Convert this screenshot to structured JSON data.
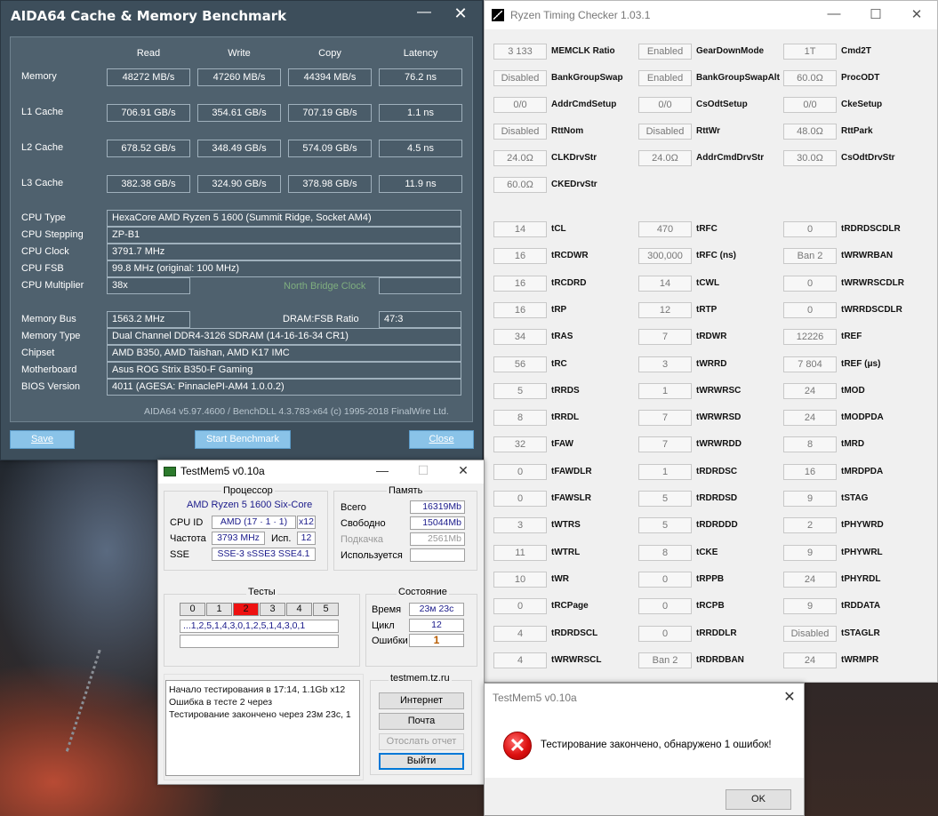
{
  "aida": {
    "title": "AIDA64 Cache & Memory Benchmark",
    "min_glyph": "—",
    "close_glyph": "✕",
    "columns": [
      "Read",
      "Write",
      "Copy",
      "Latency"
    ],
    "bench_rows": [
      {
        "label": "Memory",
        "values": [
          "48272 MB/s",
          "47260 MB/s",
          "44394 MB/s",
          "76.2 ns"
        ]
      },
      {
        "label": "L1 Cache",
        "values": [
          "706.91 GB/s",
          "354.61 GB/s",
          "707.19 GB/s",
          "1.1 ns"
        ]
      },
      {
        "label": "L2 Cache",
        "values": [
          "678.52 GB/s",
          "348.49 GB/s",
          "574.09 GB/s",
          "4.5 ns"
        ]
      },
      {
        "label": "L3 Cache",
        "values": [
          "382.38 GB/s",
          "324.90 GB/s",
          "378.98 GB/s",
          "11.9 ns"
        ]
      }
    ],
    "info_rows": [
      {
        "label": "CPU Type",
        "value": "HexaCore AMD Ryzen 5 1600  (Summit Ridge, Socket AM4)"
      },
      {
        "label": "CPU Stepping",
        "value": "ZP-B1"
      },
      {
        "label": "CPU Clock",
        "value": "3791.7 MHz"
      },
      {
        "label": "CPU FSB",
        "value": "99.8 MHz  (original: 100 MHz)"
      },
      {
        "label": "CPU Multiplier",
        "value": "38x"
      }
    ],
    "north_bridge_label": "North Bridge Clock",
    "mem_bus_label": "Memory Bus",
    "mem_bus_value": "1563.2 MHz",
    "dram_fsb_label": "DRAM:FSB Ratio",
    "dram_fsb_value": "47:3",
    "sys_rows": [
      {
        "label": "Memory Type",
        "value": "Dual Channel DDR4-3126 SDRAM  (14-16-16-34 CR1)"
      },
      {
        "label": "Chipset",
        "value": "AMD B350, AMD Taishan, AMD K17 IMC"
      },
      {
        "label": "Motherboard",
        "value": "Asus ROG Strix B350-F Gaming"
      },
      {
        "label": "BIOS Version",
        "value": "4011  (AGESA: PinnaclePI-AM4 1.0.0.2)"
      }
    ],
    "footer": "AIDA64 v5.97.4600 / BenchDLL 4.3.783-x64  (c) 1995-2018 FinalWire Ltd.",
    "buttons": {
      "save": "Save",
      "start": "Start Benchmark",
      "close": "Close"
    }
  },
  "rtc": {
    "title": "Ryzen Timing Checker 1.03.1",
    "tb": {
      "min": "—",
      "max": "☐",
      "close": "✕"
    },
    "top_rows": [
      [
        [
          "3 133",
          "MEMCLK Ratio"
        ],
        [
          "Enabled",
          "GearDownMode"
        ],
        [
          "1T",
          "Cmd2T"
        ]
      ],
      [
        [
          "Disabled",
          "BankGroupSwap"
        ],
        [
          "Enabled",
          "BankGroupSwapAlt"
        ],
        [
          "60.0Ω",
          "ProcODT"
        ]
      ],
      [
        [
          "0/0",
          "AddrCmdSetup"
        ],
        [
          "0/0",
          "CsOdtSetup"
        ],
        [
          "0/0",
          "CkeSetup"
        ]
      ],
      [
        [
          "Disabled",
          "RttNom"
        ],
        [
          "Disabled",
          "RttWr"
        ],
        [
          "48.0Ω",
          "RttPark"
        ]
      ],
      [
        [
          "24.0Ω",
          "CLKDrvStr"
        ],
        [
          "24.0Ω",
          "AddrCmdDrvStr"
        ],
        [
          "30.0Ω",
          "CsOdtDrvStr"
        ]
      ],
      [
        [
          "60.0Ω",
          "CKEDrvStr"
        ]
      ]
    ],
    "timing_rows": [
      [
        [
          "14",
          "tCL"
        ],
        [
          "470",
          "tRFC"
        ],
        [
          "0",
          "tRDRDSCDLR"
        ]
      ],
      [
        [
          "16",
          "tRCDWR"
        ],
        [
          "300,000",
          "tRFC (ns)"
        ],
        [
          "Ban 2",
          "tWRWRBAN"
        ]
      ],
      [
        [
          "16",
          "tRCDRD"
        ],
        [
          "14",
          "tCWL"
        ],
        [
          "0",
          "tWRWRSCDLR"
        ]
      ],
      [
        [
          "16",
          "tRP"
        ],
        [
          "12",
          "tRTP"
        ],
        [
          "0",
          "tWRRDSCDLR"
        ]
      ],
      [
        [
          "34",
          "tRAS"
        ],
        [
          "7",
          "tRDWR"
        ],
        [
          "12226",
          "tREF"
        ]
      ],
      [
        [
          "56",
          "tRC"
        ],
        [
          "3",
          "tWRRD"
        ],
        [
          "7 804",
          "tREF (μs)"
        ]
      ],
      [
        [
          "5",
          "tRRDS"
        ],
        [
          "1",
          "tWRWRSC"
        ],
        [
          "24",
          "tMOD"
        ]
      ],
      [
        [
          "8",
          "tRRDL"
        ],
        [
          "7",
          "tWRWRSD"
        ],
        [
          "24",
          "tMODPDA"
        ]
      ],
      [
        [
          "32",
          "tFAW"
        ],
        [
          "7",
          "tWRWRDD"
        ],
        [
          "8",
          "tMRD"
        ]
      ],
      [
        [
          "0",
          "tFAWDLR"
        ],
        [
          "1",
          "tRDRDSC"
        ],
        [
          "16",
          "tMRDPDA"
        ]
      ],
      [
        [
          "0",
          "tFAWSLR"
        ],
        [
          "5",
          "tRDRDSD"
        ],
        [
          "9",
          "tSTAG"
        ]
      ],
      [
        [
          "3",
          "tWTRS"
        ],
        [
          "5",
          "tRDRDDD"
        ],
        [
          "2",
          "tPHYWRD"
        ]
      ],
      [
        [
          "11",
          "tWTRL"
        ],
        [
          "8",
          "tCKE"
        ],
        [
          "9",
          "tPHYWRL"
        ]
      ],
      [
        [
          "10",
          "tWR"
        ],
        [
          "0",
          "tRPPB"
        ],
        [
          "24",
          "tPHYRDL"
        ]
      ],
      [
        [
          "0",
          "tRCPage"
        ],
        [
          "0",
          "tRCPB"
        ],
        [
          "9",
          "tRDDATA"
        ]
      ],
      [
        [
          "4",
          "tRDRDSCL"
        ],
        [
          "0",
          "tRRDDLR"
        ],
        [
          "Disabled",
          "tSTAGLR"
        ]
      ],
      [
        [
          "4",
          "tWRWRSCL"
        ],
        [
          "Ban 2",
          "tRDRDBAN"
        ],
        [
          "24",
          "tWRMPR"
        ]
      ]
    ]
  },
  "tm": {
    "title": "TestMem5 v0.10a",
    "tb": {
      "min": "—",
      "max": "☐",
      "close": "✕"
    },
    "cpu_group": "Процессор",
    "cpu_name": "AMD Ryzen 5 1600 Six-Core",
    "cpu_id_label": "CPU ID",
    "cpu_id_value": "AMD  (17 · 1 · 1)",
    "cpu_id_threads": "x12",
    "freq_label": "Частота",
    "freq_value": "3793 MHz",
    "used_label": "Исп.",
    "used_value": "12",
    "sse_label": "SSE",
    "sse_value": "SSE-3 sSSE3 SSE4.1",
    "mem_group": "Память",
    "mem_rows": [
      {
        "label": "Всего",
        "value": "16319Mb"
      },
      {
        "label": "Свободно",
        "value": "15044Mb"
      },
      {
        "label": "Подкачка",
        "value": "2561Mb"
      },
      {
        "label": "Используется",
        "value": ""
      }
    ],
    "tests_group": "Тесты",
    "tabs": [
      "0",
      "1",
      "2",
      "3",
      "4",
      "5"
    ],
    "error_tab": "2",
    "sequence": "...1,2,5,1,4,3,0,1,2,5,1,4,3,0,1",
    "state_group": "Состояние",
    "state_rows": [
      {
        "label": "Время",
        "value": "23м 23с"
      },
      {
        "label": "Цикл",
        "value": "12"
      },
      {
        "label": "Ошибки",
        "value": "1"
      }
    ],
    "log": [
      "Начало тестирования в 17:14, 1.1Gb x12",
      "Ошибка в тесте 2 через",
      "Тестирование закончено через 23м 23с, 1"
    ],
    "site_group": "testmem.tz.ru",
    "buttons": {
      "internet": "Интернет",
      "mail": "Почта",
      "report": "Отослать отчет",
      "exit": "Выйти"
    }
  },
  "dlg": {
    "title": "TestMem5 v0.10a",
    "close": "✕",
    "icon": "✕",
    "message": "Тестирование закончено, обнаружено 1 ошибок!",
    "ok": "OK"
  },
  "colors": {
    "aida_bg": "#3d4e5b",
    "aida_button": "#8ac3e8",
    "error_red": "#e11111"
  }
}
